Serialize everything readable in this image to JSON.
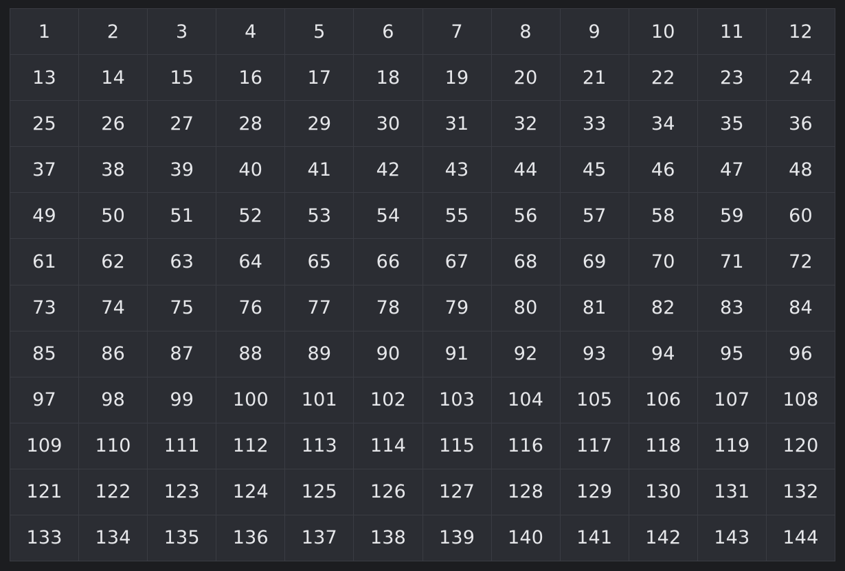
{
  "grid": {
    "cells": [
      "1",
      "2",
      "3",
      "4",
      "5",
      "6",
      "7",
      "8",
      "9",
      "10",
      "11",
      "12",
      "13",
      "14",
      "15",
      "16",
      "17",
      "18",
      "19",
      "20",
      "21",
      "22",
      "23",
      "24",
      "25",
      "26",
      "27",
      "28",
      "29",
      "30",
      "31",
      "32",
      "33",
      "34",
      "35",
      "36",
      "37",
      "38",
      "39",
      "40",
      "41",
      "42",
      "43",
      "44",
      "45",
      "46",
      "47",
      "48",
      "49",
      "50",
      "51",
      "52",
      "53",
      "54",
      "55",
      "56",
      "57",
      "58",
      "59",
      "60",
      "61",
      "62",
      "63",
      "64",
      "65",
      "66",
      "67",
      "68",
      "69",
      "70",
      "71",
      "72",
      "73",
      "74",
      "75",
      "76",
      "77",
      "78",
      "79",
      "80",
      "81",
      "82",
      "83",
      "84",
      "85",
      "86",
      "87",
      "88",
      "89",
      "90",
      "91",
      "92",
      "93",
      "94",
      "95",
      "96",
      "97",
      "98",
      "99",
      "100",
      "101",
      "102",
      "103",
      "104",
      "105",
      "106",
      "107",
      "108",
      "109",
      "110",
      "111",
      "112",
      "113",
      "114",
      "115",
      "116",
      "117",
      "118",
      "119",
      "120",
      "121",
      "122",
      "123",
      "124",
      "125",
      "126",
      "127",
      "128",
      "129",
      "130",
      "131",
      "132",
      "133",
      "134",
      "135",
      "136",
      "137",
      "138",
      "139",
      "140",
      "141",
      "142",
      "143",
      "144"
    ]
  },
  "colors": {
    "page_background": "#1c1d20",
    "cell_background": "#2b2d33",
    "grid_line": "#3a3c43",
    "text": "#e6e7ea"
  }
}
